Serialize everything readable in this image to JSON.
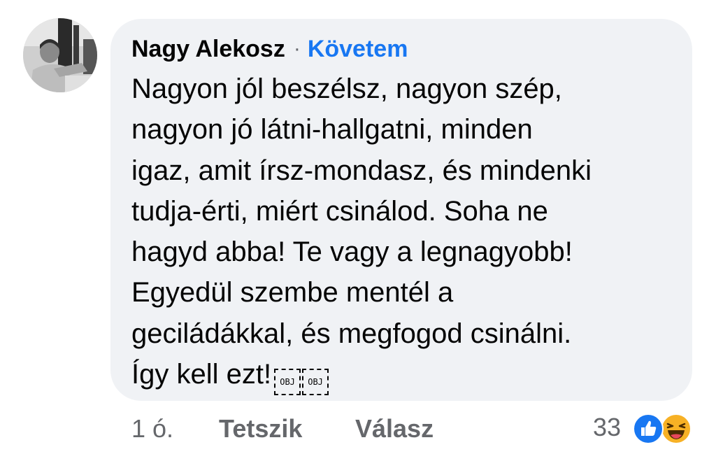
{
  "comment": {
    "author": "Nagy Alekosz",
    "separator": "·",
    "follow_label": "Követem",
    "text_lines": [
      "Nagyon jól beszélsz, nagyon szép,",
      "nagyon jó látni-hallgatni, minden",
      "igaz, amit írsz-mondasz, és mindenki",
      "tudja-érti, miért csinálod. Soha ne",
      "hagyd abba! Te vagy a legnagyobb!",
      "Egyedül szembe mentél a",
      "geciládákkal, és megfogod csinálni.",
      "Így kell ezt!"
    ],
    "obj_glyph_label": "OBJ"
  },
  "footer": {
    "time": "1 ó.",
    "like_label": "Tetszik",
    "reply_label": "Válasz",
    "reaction_count": "33",
    "reaction_icons": [
      "like-icon",
      "haha-icon"
    ]
  },
  "colors": {
    "bubble_bg": "#f0f2f5",
    "link_blue": "#1877f2",
    "secondary_text": "#65676b",
    "primary_text": "#050505"
  }
}
